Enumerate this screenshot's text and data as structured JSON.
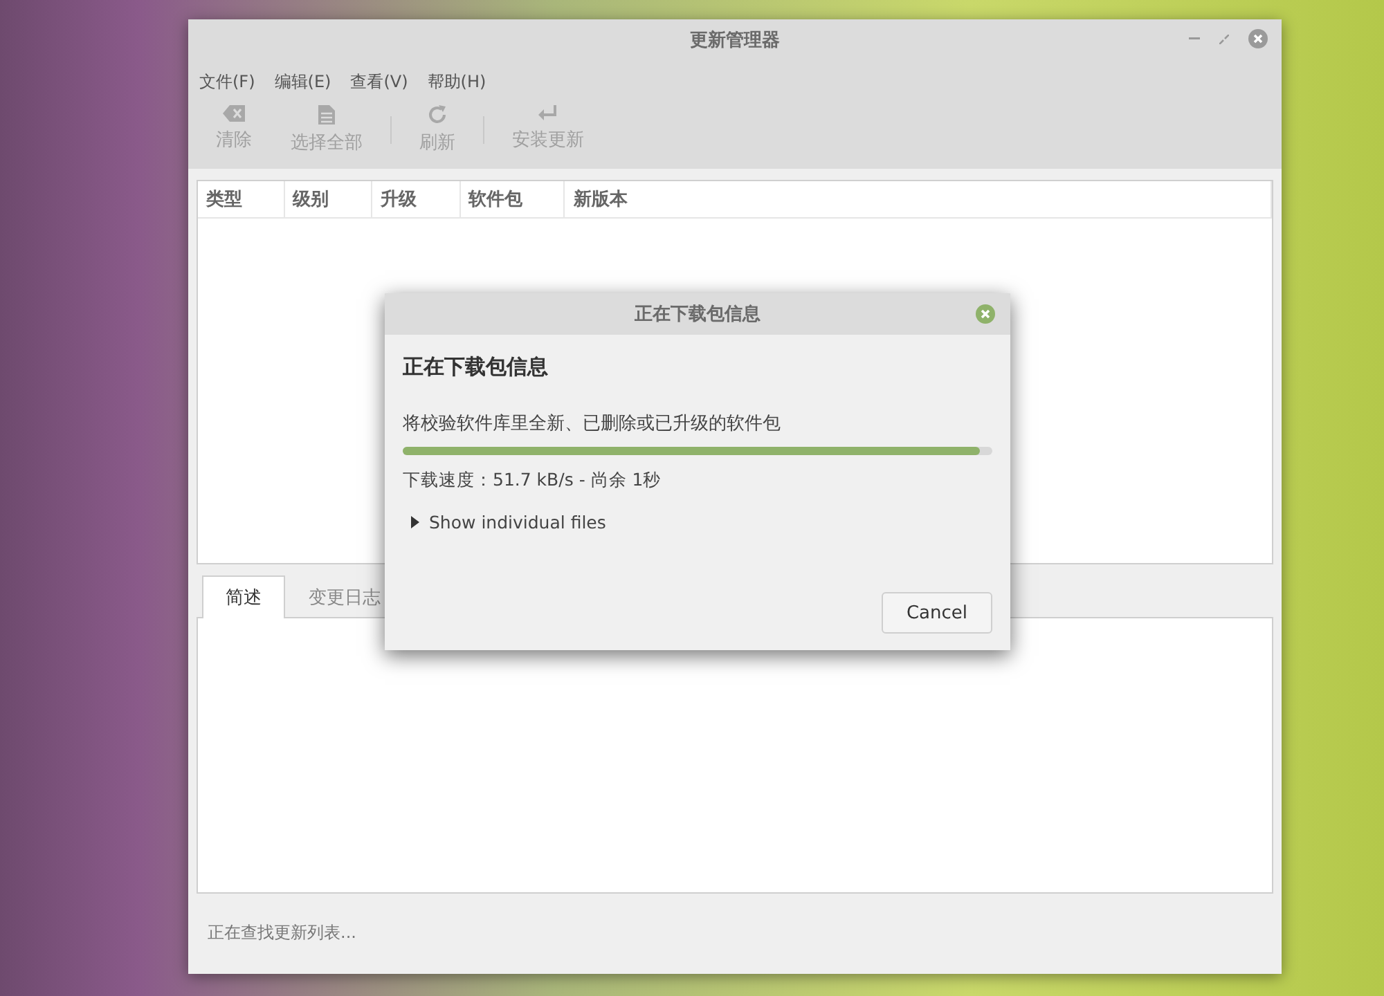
{
  "window": {
    "title": "更新管理器"
  },
  "menu": [
    "文件(F)",
    "编辑(E)",
    "查看(V)",
    "帮助(H)"
  ],
  "toolbar": [
    {
      "kind": "clear",
      "label": "清除",
      "disabled": true
    },
    {
      "kind": "select-all",
      "label": "选择全部",
      "disabled": true
    },
    {
      "kind": "refresh",
      "label": "刷新",
      "disabled": true
    },
    {
      "kind": "install",
      "label": "安装更新",
      "disabled": true
    }
  ],
  "table": {
    "columns": [
      "类型",
      "级别",
      "升级",
      "软件包",
      "新版本"
    ]
  },
  "tabs": [
    {
      "label": "简述",
      "selected": true
    },
    {
      "label": "变更日志",
      "selected": false
    }
  ],
  "status_bar": "正在查找更新列表...",
  "dialog": {
    "title": "正在下载包信息",
    "heading": "正在下载包信息",
    "message": "将校验软件库里全新、已删除或已升级的软件包",
    "level": 0.98,
    "speed": "下载速度：51.7 kB/s - 尚余 1秒",
    "expander": {
      "label": "Show individual files",
      "expanded": false
    },
    "button": "Cancel"
  }
}
